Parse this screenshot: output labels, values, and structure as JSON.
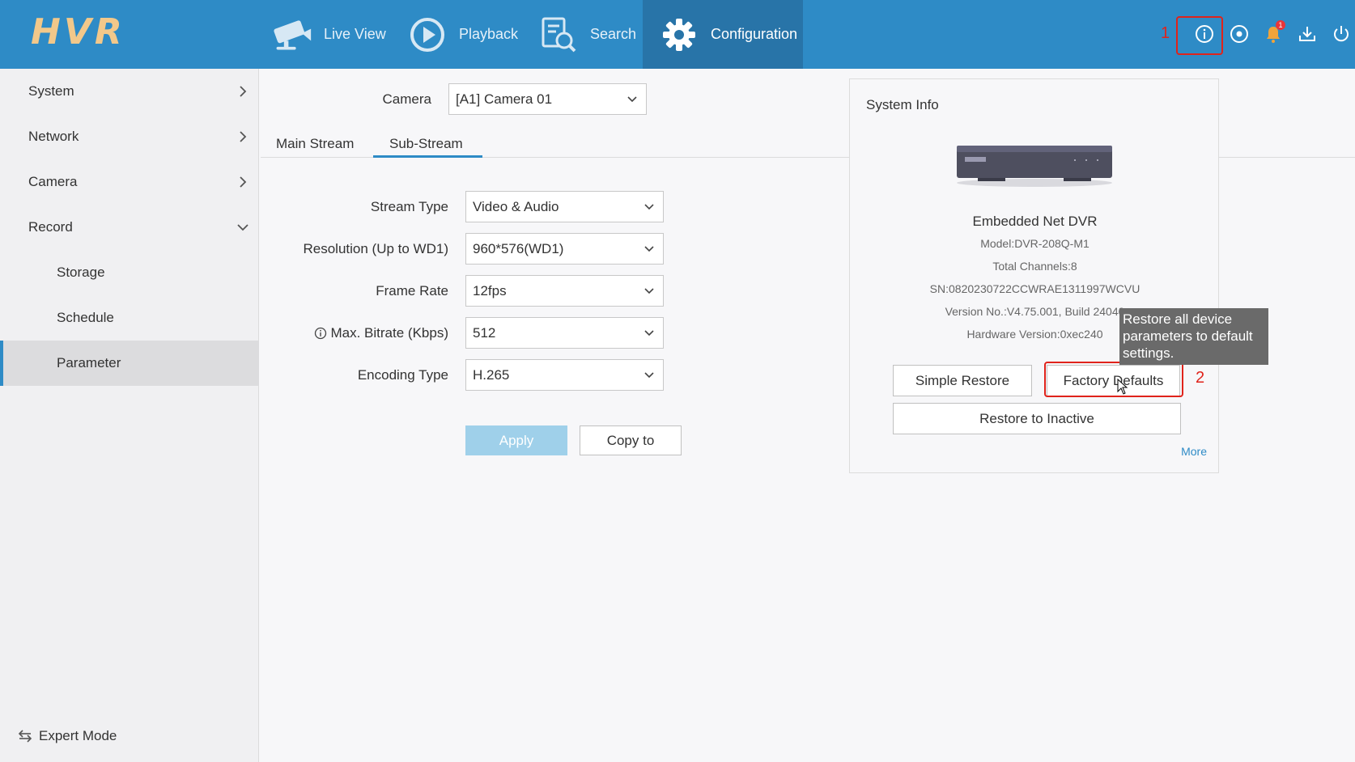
{
  "header": {
    "logo": "HVR",
    "nav": [
      {
        "label": "Live View",
        "icon": "camera-icon"
      },
      {
        "label": "Playback",
        "icon": "play-icon"
      },
      {
        "label": "Search",
        "icon": "search-icon"
      },
      {
        "label": "Configuration",
        "icon": "gear-icon"
      }
    ],
    "annotation_1": "1",
    "notification_count": "1"
  },
  "sidebar": {
    "items": [
      {
        "label": "System"
      },
      {
        "label": "Network"
      },
      {
        "label": "Camera"
      },
      {
        "label": "Record"
      },
      {
        "label": "Storage"
      },
      {
        "label": "Schedule"
      },
      {
        "label": "Parameter"
      }
    ],
    "expert_mode": "Expert Mode"
  },
  "main": {
    "camera_label": "Camera",
    "camera_value": "[A1] Camera 01",
    "tabs": [
      {
        "label": "Main Stream"
      },
      {
        "label": "Sub-Stream"
      }
    ],
    "fields": [
      {
        "label": "Stream Type",
        "value": "Video & Audio"
      },
      {
        "label": "Resolution (Up to WD1)",
        "value": "960*576(WD1)"
      },
      {
        "label": "Frame Rate",
        "value": "12fps"
      },
      {
        "label": "Max. Bitrate (Kbps)",
        "value": "512"
      },
      {
        "label": "Encoding Type",
        "value": "H.265"
      }
    ],
    "apply_label": "Apply",
    "copy_label": "Copy to"
  },
  "system_info": {
    "title": "System Info",
    "device_name": "Embedded Net DVR",
    "model": "Model:DVR-208Q-M1",
    "channels": "Total Channels:8",
    "sn": "SN:0820230722CCWRAE1311997WCVU",
    "version": "Version No.:V4.75.001, Build 24040",
    "hardware": "Hardware Version:0xec240",
    "simple_restore": "Simple Restore",
    "factory_defaults": "Factory Defaults",
    "restore_inactive": "Restore to Inactive",
    "more": "More",
    "annotation_2": "2",
    "tooltip": "Restore all device parameters to default settings."
  }
}
